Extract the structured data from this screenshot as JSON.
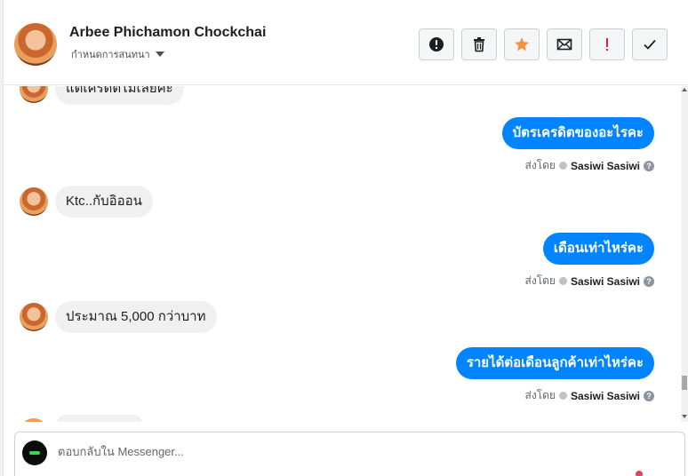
{
  "header": {
    "contact_name": "Arbee Phichamon Chockchai",
    "assign_label": "กำหนดการสนทนา"
  },
  "toolbar": {
    "buttons": [
      {
        "name": "report-spam-button",
        "icon": "exclamation-circle-icon"
      },
      {
        "name": "delete-button",
        "icon": "trash-icon"
      },
      {
        "name": "star-button",
        "icon": "star-icon",
        "color": "#f7923a"
      },
      {
        "name": "mark-unread-button",
        "icon": "envelope-icon"
      },
      {
        "name": "flag-important-button",
        "icon": "exclamation-icon",
        "color": "#e41e3f"
      },
      {
        "name": "mark-done-button",
        "icon": "checkmark-icon"
      }
    ]
  },
  "thread": {
    "messages": [
      {
        "direction": "in",
        "text": "แต่เครดิตไม่เลยค่ะ"
      },
      {
        "direction": "out",
        "text": "บัตรเครดิตของอะไรคะ",
        "sent_prefix": "ส่งโดย",
        "agent": "Sasiwi Sasiwi"
      },
      {
        "direction": "in",
        "text": "Ktc..กับอิออน"
      },
      {
        "direction": "out",
        "text": "เดือนเท่าไหร่คะ",
        "sent_prefix": "ส่งโดย",
        "agent": "Sasiwi Sasiwi"
      },
      {
        "direction": "in",
        "text": "ประมาณ 5,000 กว่าบาท"
      },
      {
        "direction": "out",
        "text": "รายได้ต่อเดือนลูกค้าเท่าไหร่คะ",
        "sent_prefix": "ส่งโดย",
        "agent": "Sasiwi Sasiwi"
      }
    ],
    "help_glyph": "?"
  },
  "composer": {
    "placeholder": "ตอบกลับใน Messenger..."
  },
  "colors": {
    "outgoing_bubble": "#0084ff",
    "incoming_bubble": "#f0f0f0"
  }
}
